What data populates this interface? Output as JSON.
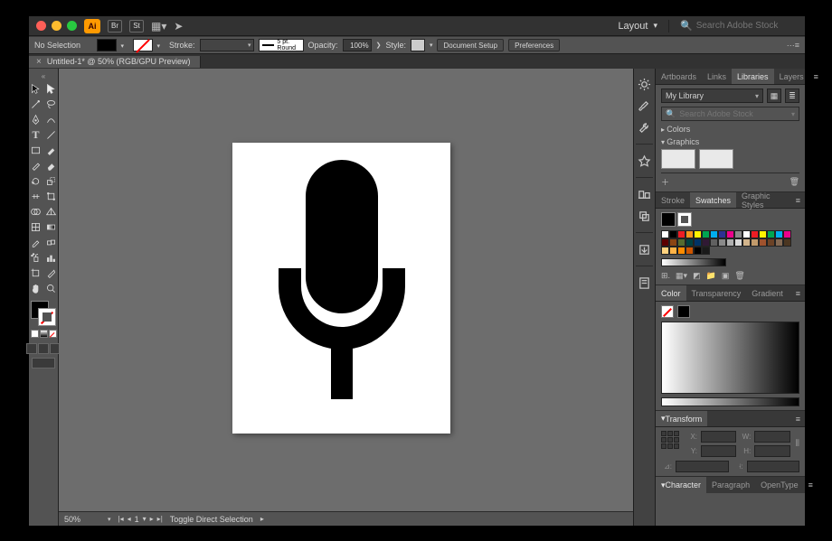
{
  "titlebar": {
    "app_badge": "Ai",
    "chip1": "Br",
    "chip2": "St",
    "layout_label": "Layout",
    "search_placeholder": "Search Adobe Stock"
  },
  "controlbar": {
    "selection": "No Selection",
    "stroke_label": "Stroke:",
    "stroke_style": "5 pt. Round",
    "opacity_label": "Opacity:",
    "opacity_value": "100%",
    "style_label": "Style:",
    "btn_docsetup": "Document Setup",
    "btn_prefs": "Preferences"
  },
  "doctab": {
    "title": "Untitled-1* @ 50% (RGB/GPU Preview)"
  },
  "statusbar": {
    "zoom": "50%",
    "artboard_index": "1",
    "tool_label": "Toggle Direct Selection"
  },
  "panels": {
    "top_tabs": [
      "Artboards",
      "Links",
      "Libraries",
      "Layers"
    ],
    "top_active_index": 2,
    "library_name": "My Library",
    "lib_search_placeholder": "Search Adobe Stock",
    "lib_section_colors": "Colors",
    "lib_section_graphics": "Graphics",
    "swatch_tabs": [
      "Stroke",
      "Swatches",
      "Graphic Styles"
    ],
    "swatch_active_index": 1,
    "color_tabs": [
      "Color",
      "Transparency",
      "Gradient"
    ],
    "color_active_index": 0,
    "transform_tab": "Transform",
    "transform_labels": {
      "x": "X:",
      "y": "Y:",
      "w": "W:",
      "h": "H:",
      "a": "⊿:"
    },
    "char_tabs": [
      "Character",
      "Paragraph",
      "OpenType"
    ],
    "char_active_index": 0
  },
  "swatch_colors": [
    "#ffffff",
    "#000000",
    "#ed1c24",
    "#f7941d",
    "#fff200",
    "#00a651",
    "#00aeef",
    "#2e3192",
    "#ec008c",
    "#898989",
    "#ffffff",
    "#ed1c24",
    "#fff200",
    "#00a651",
    "#00aeef",
    "#ec008c",
    "#5c0000",
    "#8b4513",
    "#556b2f",
    "#004040",
    "#003366",
    "#301934",
    "#606060",
    "#8a8a8a",
    "#b0b0b0",
    "#d9d9d9",
    "#d2b48c",
    "#c19a6b",
    "#a0522d",
    "#6b4226",
    "#836953",
    "#4b3621",
    "#ffd27f",
    "#ffb347",
    "#ff8c00",
    "#cc5500",
    "#000000",
    "#1a1a1a"
  ]
}
